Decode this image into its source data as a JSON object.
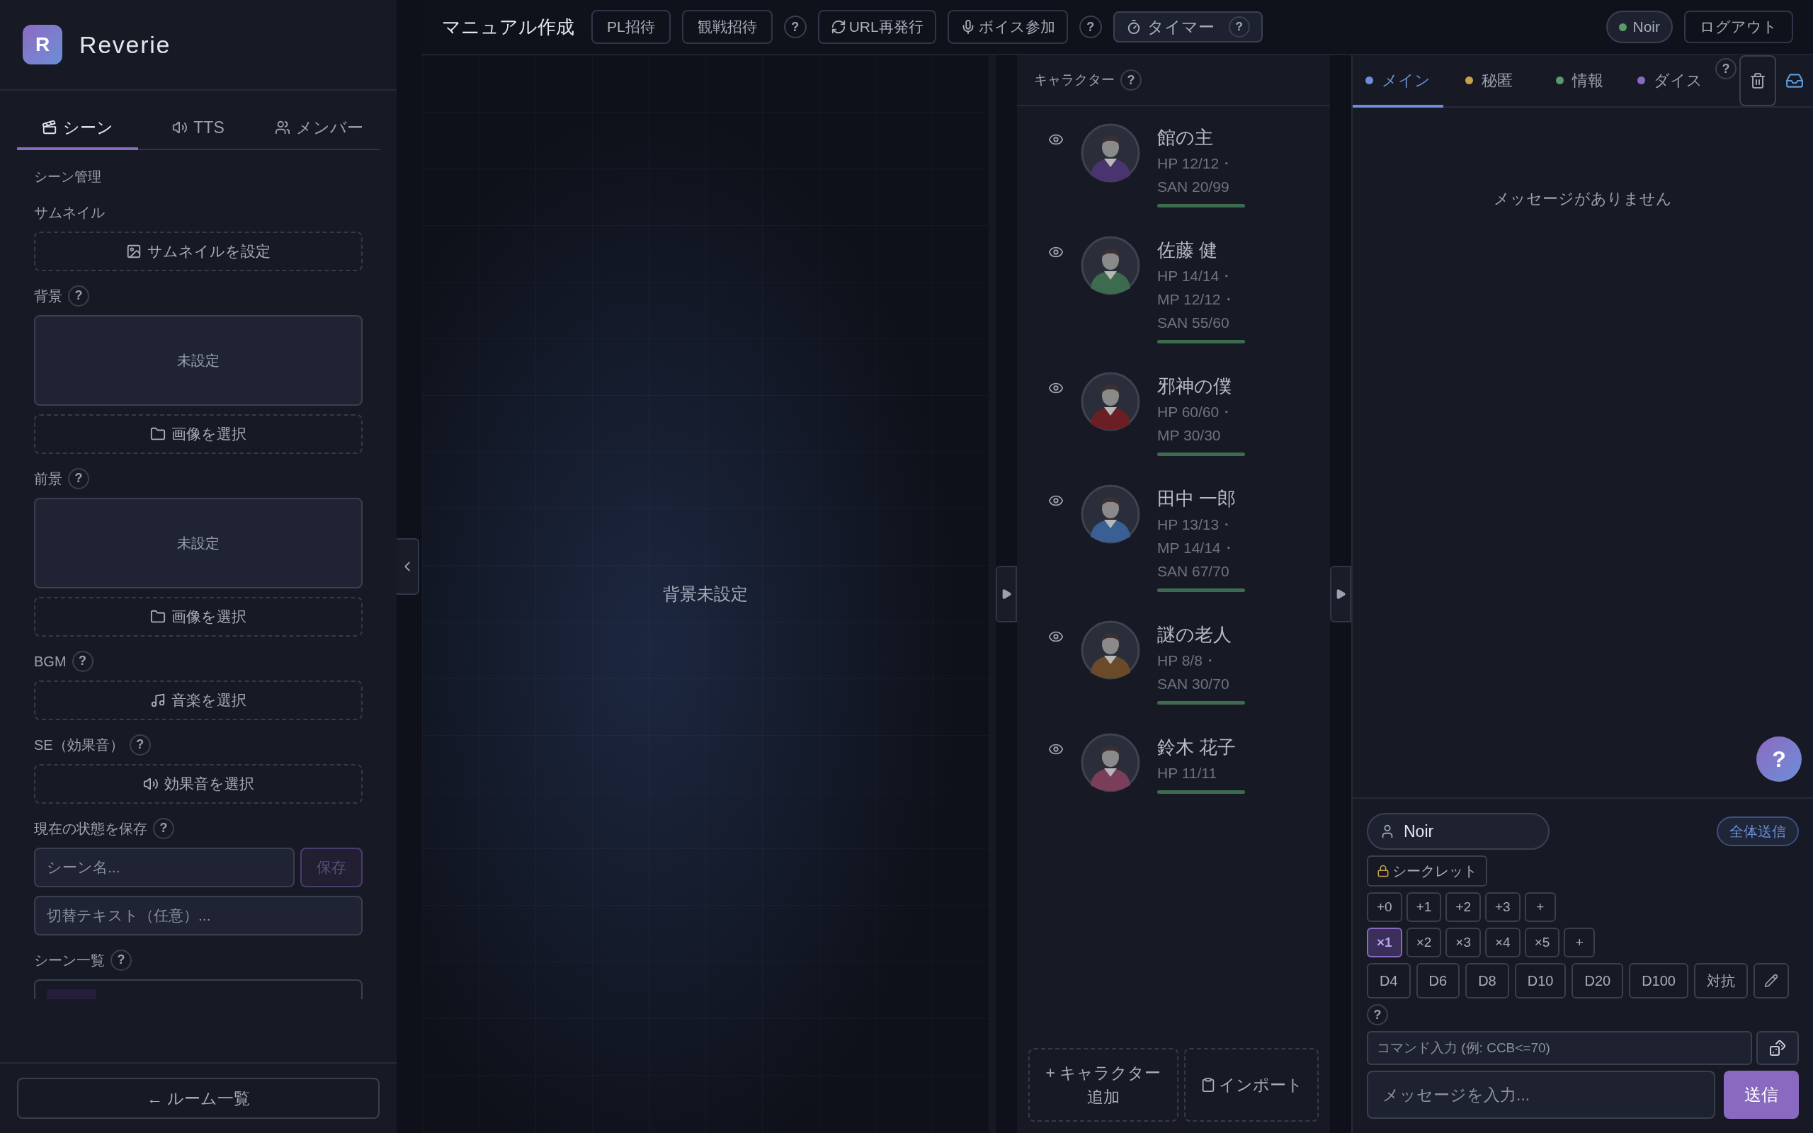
{
  "app": {
    "logo_letter": "R",
    "name": "Reverie"
  },
  "side_tabs": [
    {
      "label": "シーン",
      "selected": true
    },
    {
      "label": "TTS",
      "selected": false
    },
    {
      "label": "メンバー",
      "selected": false
    }
  ],
  "scene": {
    "heading": "シーン管理",
    "sections": [
      {
        "kind": "thumbnail",
        "label": "サムネイル",
        "button": "サムネイルを設定"
      },
      {
        "kind": "background",
        "label": "背景",
        "help": "?",
        "preview": "未設定",
        "button": "画像を選択"
      },
      {
        "kind": "foreground",
        "label": "前景",
        "help": "?",
        "preview": "未設定",
        "button": "画像を選択"
      },
      {
        "kind": "bgm",
        "label": "BGM",
        "help": "?",
        "button": "音楽を選択"
      },
      {
        "kind": "se",
        "label": "SE（効果音）",
        "help": "?",
        "button": "効果音を選択"
      },
      {
        "kind": "save",
        "label": "現在の状態を保存",
        "help": "?",
        "name_field": {
          "placeholder": "シーン名..."
        },
        "button": "保存",
        "text_field": {
          "placeholder": "切替テキスト（任意）..."
        }
      },
      {
        "kind": "list",
        "label": "シーン一覧",
        "help": "?"
      }
    ],
    "back": "← ルーム一覧"
  },
  "topbar": {
    "title": "マニュアル作成",
    "buttons": [
      {
        "kind": "invite",
        "label": "PL招待"
      },
      {
        "kind": "spectate",
        "label": "観戦招待"
      },
      {
        "kind": "help",
        "label": "?"
      },
      {
        "kind": "reissue",
        "label": "URL再発行"
      },
      {
        "kind": "voice",
        "label": "ボイス参加"
      },
      {
        "kind": "help",
        "label": "?"
      },
      {
        "kind": "timer",
        "label": "タイマー",
        "help": "?"
      }
    ],
    "user": "Noir",
    "logout": "ログアウト"
  },
  "canvas": {
    "empty": "背景未設定"
  },
  "characters": {
    "title": "キャラクター",
    "help": "?",
    "items": [
      {
        "name": "館の主",
        "stats": "HP 12/12・SAN 20/99",
        "color": "#4a3470",
        "level": 1
      },
      {
        "name": "佐藤 健",
        "stats": "HP 14/14・MP 12/12・SAN 55/60",
        "color": "#3d6b4f",
        "level": 1
      },
      {
        "name": "邪神の僕",
        "stats": "HP 60/60・MP 30/30",
        "color": "#6b1f24",
        "level": 1
      },
      {
        "name": "田中 一郎",
        "stats": "HP 13/13・MP 14/14・SAN 67/70",
        "color": "#3a5f95",
        "level": 1
      },
      {
        "name": "謎の老人",
        "stats": "HP 8/8・SAN 30/70",
        "color": "#6b4a2a",
        "level": 1
      },
      {
        "name": "鈴木 花子",
        "stats": "HP 11/11",
        "color": "#7a3d5a",
        "level": 1
      }
    ],
    "add": "+ キャラクター追加",
    "import": "インポート"
  },
  "chat": {
    "tabs": [
      {
        "label": "メイン",
        "color": "#6a8fd8",
        "selected": true
      },
      {
        "label": "秘匿",
        "color": "#c8a24a",
        "selected": false
      },
      {
        "label": "情報",
        "color": "#5a9a6a",
        "selected": false
      },
      {
        "label": "ダイス",
        "color": "#8a6ac0",
        "selected": false
      }
    ],
    "tabs_help": "?",
    "empty": "メッセージがありません",
    "floating_help": "?",
    "speaker": "Noir",
    "broadcast": "全体送信",
    "secret": "シークレット",
    "modifiers": [
      {
        "label": "+0",
        "selected": false
      },
      {
        "label": "+1",
        "selected": false
      },
      {
        "label": "+2",
        "selected": false
      },
      {
        "label": "+3",
        "selected": false
      },
      {
        "label": "+",
        "selected": false
      }
    ],
    "multipliers": [
      {
        "label": "×1",
        "selected": true
      },
      {
        "label": "×2",
        "selected": false
      },
      {
        "label": "×3",
        "selected": false
      },
      {
        "label": "×4",
        "selected": false
      },
      {
        "label": "×5",
        "selected": false
      },
      {
        "label": "+",
        "selected": false
      }
    ],
    "dice": [
      "D4",
      "D6",
      "D8",
      "D10",
      "D20",
      "D100",
      "対抗"
    ],
    "dice_help": "?",
    "command_placeholder": "コマンド入力 (例: CCB<=70)",
    "message_placeholder": "メッセージを入力...",
    "send": "送信"
  }
}
